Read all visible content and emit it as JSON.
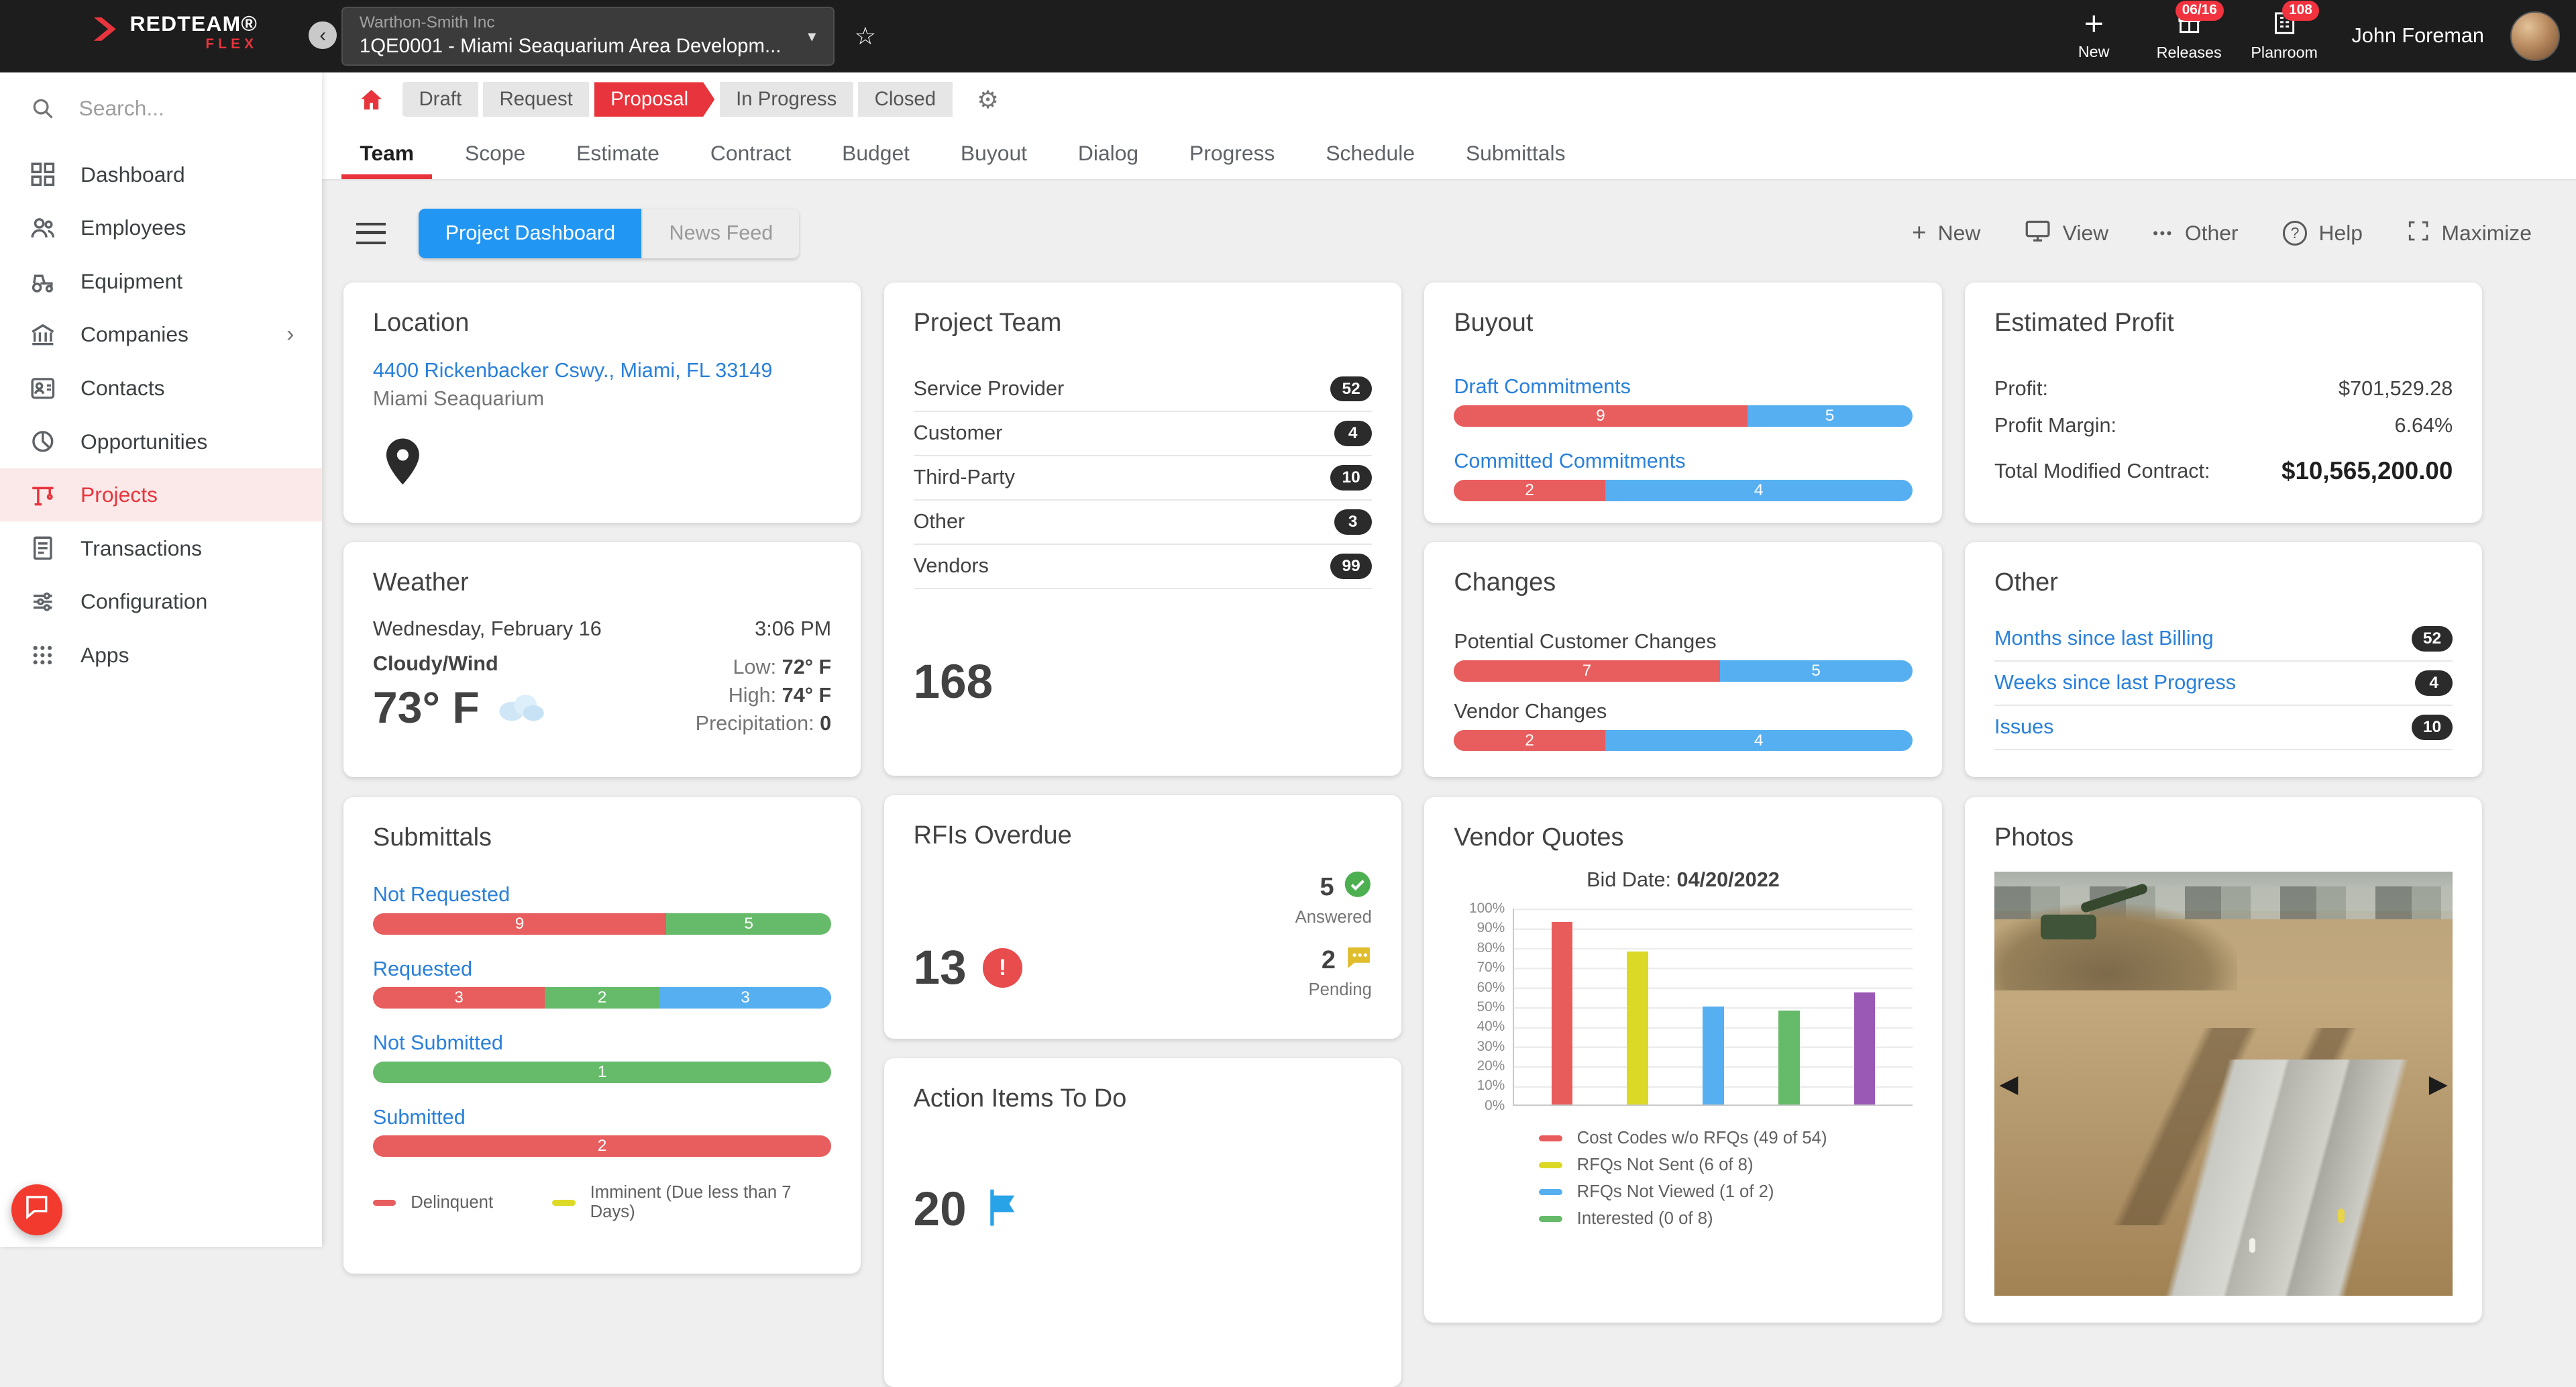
{
  "topbar": {
    "brand": "REDTEAM®",
    "brand_sub": "FLEX",
    "project_company": "Warthon-Smith Inc",
    "project_name": "1QE0001 - Miami Seaquarium Area Developm...",
    "new_label": "New",
    "releases_label": "Releases",
    "releases_badge": "06/16",
    "planroom_label": "Planroom",
    "planroom_badge": "108",
    "user_name": "John Foreman"
  },
  "sidebar": {
    "search_placeholder": "Search...",
    "items": [
      {
        "label": "Dashboard"
      },
      {
        "label": "Employees"
      },
      {
        "label": "Equipment"
      },
      {
        "label": "Companies"
      },
      {
        "label": "Contacts"
      },
      {
        "label": "Opportunities"
      },
      {
        "label": "Projects"
      },
      {
        "label": "Transactions"
      },
      {
        "label": "Configuration"
      },
      {
        "label": "Apps"
      }
    ]
  },
  "status_bar": {
    "active": "Proposal",
    "tabs": [
      {
        "label": "Draft"
      },
      {
        "label": "Request"
      },
      {
        "label": "Proposal"
      },
      {
        "label": "In Progress"
      },
      {
        "label": "Closed"
      }
    ]
  },
  "nav_tabs": {
    "active": "Team",
    "tabs": [
      {
        "label": "Team"
      },
      {
        "label": "Scope"
      },
      {
        "label": "Estimate"
      },
      {
        "label": "Contract"
      },
      {
        "label": "Budget"
      },
      {
        "label": "Buyout"
      },
      {
        "label": "Dialog"
      },
      {
        "label": "Progress"
      },
      {
        "label": "Schedule"
      },
      {
        "label": "Submittals"
      }
    ]
  },
  "toolbar": {
    "dashboard_button": "Project Dashboard",
    "news_feed_button": "News Feed",
    "new_label": "New",
    "view_label": "View",
    "other_label": "Other",
    "help_label": "Help",
    "maximize_label": "Maximize"
  },
  "location": {
    "title": "Location",
    "address": "4400 Rickenbacker Cswy., Miami, FL 33149",
    "place": "Miami Seaquarium"
  },
  "weather": {
    "title": "Weather",
    "date": "Wednesday, February 16",
    "time": "3:06 PM",
    "condition": "Cloudy/Wind",
    "low_label": "Low:",
    "low_value": "72° F",
    "temp": "73° F",
    "high_label": "High:",
    "high_value": "74° F",
    "precip_label": "Precipitation:",
    "precip_value": "0"
  },
  "submittals": {
    "title": "Submittals",
    "groups": [
      {
        "label": "Not Requested",
        "segments": [
          {
            "value": "9",
            "color": "red",
            "width": "64%"
          },
          {
            "value": "5",
            "color": "green",
            "width": "36%"
          }
        ]
      },
      {
        "label": "Requested",
        "segments": [
          {
            "value": "3",
            "color": "red",
            "width": "37.5%"
          },
          {
            "value": "2",
            "color": "green",
            "width": "25%"
          },
          {
            "value": "3",
            "color": "blue",
            "width": "37.5%"
          }
        ]
      },
      {
        "label": "Not Submitted",
        "segments": [
          {
            "value": "1",
            "color": "green",
            "width": "100%"
          }
        ]
      },
      {
        "label": "Submitted",
        "segments": [
          {
            "value": "2",
            "color": "red",
            "width": "100%"
          }
        ]
      }
    ],
    "legend": [
      {
        "label": "Delinquent",
        "color": "red"
      },
      {
        "label": "Imminent (Due less than 7 Days)",
        "color": "yellow"
      }
    ]
  },
  "project_team": {
    "title": "Project Team",
    "rows": [
      {
        "label": "Service Provider",
        "count": "52"
      },
      {
        "label": "Customer",
        "count": "4"
      },
      {
        "label": "Third-Party",
        "count": "10"
      },
      {
        "label": "Other",
        "count": "3"
      },
      {
        "label": "Vendors",
        "count": "99"
      }
    ],
    "total": "168"
  },
  "rfis": {
    "title": "RFIs Overdue",
    "overdue_count": "13",
    "answered_count": "5",
    "answered_label": "Answered",
    "pending_count": "2",
    "pending_label": "Pending"
  },
  "action_items": {
    "title": "Action Items To Do",
    "count": "20"
  },
  "buyout": {
    "title": "Buyout",
    "groups": [
      {
        "label": "Draft Commitments",
        "segments": [
          {
            "value": "9",
            "color": "red",
            "width": "64%"
          },
          {
            "value": "5",
            "color": "blue",
            "width": "36%"
          }
        ]
      },
      {
        "label": "Committed Commitments",
        "segments": [
          {
            "value": "2",
            "color": "red",
            "width": "33%"
          },
          {
            "value": "4",
            "color": "blue",
            "width": "67%"
          }
        ]
      }
    ]
  },
  "changes": {
    "title": "Changes",
    "groups": [
      {
        "label": "Potential Customer Changes",
        "segments": [
          {
            "value": "7",
            "color": "red",
            "width": "58%"
          },
          {
            "value": "5",
            "color": "blue",
            "width": "42%"
          }
        ]
      },
      {
        "label": "Vendor Changes",
        "segments": [
          {
            "value": "2",
            "color": "red",
            "width": "33%"
          },
          {
            "value": "4",
            "color": "blue",
            "width": "67%"
          }
        ]
      }
    ]
  },
  "vendor_quotes": {
    "title": "Vendor Quotes",
    "bid_date_label": "Bid Date:",
    "bid_date": "04/20/2022",
    "chart_data": {
      "type": "bar",
      "ylim": [
        0,
        100
      ],
      "yticks": [
        "100%",
        "90%",
        "80%",
        "70%",
        "60%",
        "50%",
        "40%",
        "30%",
        "20%",
        "10%",
        "0%"
      ],
      "grid": true,
      "legend_position": "bottom",
      "series": [
        {
          "name": "Cost Codes w/o RFQs (49 of 54)",
          "color": "#e85c5c",
          "value": 93,
          "height": "93%"
        },
        {
          "name": "RFQs Not Sent (6 of 8)",
          "color": "#dcd926",
          "value": 78,
          "height": "78%"
        },
        {
          "name": "RFQs Not Viewed (1 of 2)",
          "color": "#56aff0",
          "value": 50,
          "height": "50%"
        },
        {
          "name": "Interested (0 of 8)",
          "color": "#66bb6a",
          "value": 48,
          "height": "48%"
        },
        {
          "name": "",
          "color": "#9b59b6",
          "value": 57,
          "height": "57%"
        }
      ]
    }
  },
  "estimated_profit": {
    "title": "Estimated Profit",
    "rows": [
      {
        "label": "Profit:",
        "value": "$701,529.28"
      },
      {
        "label": "Profit Margin:",
        "value": "6.64%"
      }
    ],
    "total_label": "Total Modified Contract:",
    "total_value": "$10,565,200.00"
  },
  "card_other": {
    "title": "Other",
    "rows": [
      {
        "label": "Months since last Billing",
        "count": "52"
      },
      {
        "label": "Weeks since last Progress",
        "count": "4"
      },
      {
        "label": "Issues",
        "count": "10"
      }
    ]
  },
  "photos": {
    "title": "Photos"
  },
  "icons": {
    "back": "‹",
    "star": "☆",
    "gear": "⚙",
    "dropdown": "▾",
    "ellipsis": "•••",
    "plus": "+",
    "help": "?",
    "prev": "◀",
    "next": "▶",
    "chevron_right": "›",
    "exclamation": "!"
  },
  "colors": {
    "accent_red": "#e8343c",
    "link_blue": "#2980d9",
    "button_blue": "#2196f3",
    "bar_red": "#e85d5d",
    "bar_green": "#66bb6a",
    "bar_blue": "#56aff0",
    "bar_yellow": "#dcd926",
    "bar_purple": "#9b59b6",
    "badge_dark": "#2b2b2b",
    "topbar_dark": "#1d1d1d"
  }
}
